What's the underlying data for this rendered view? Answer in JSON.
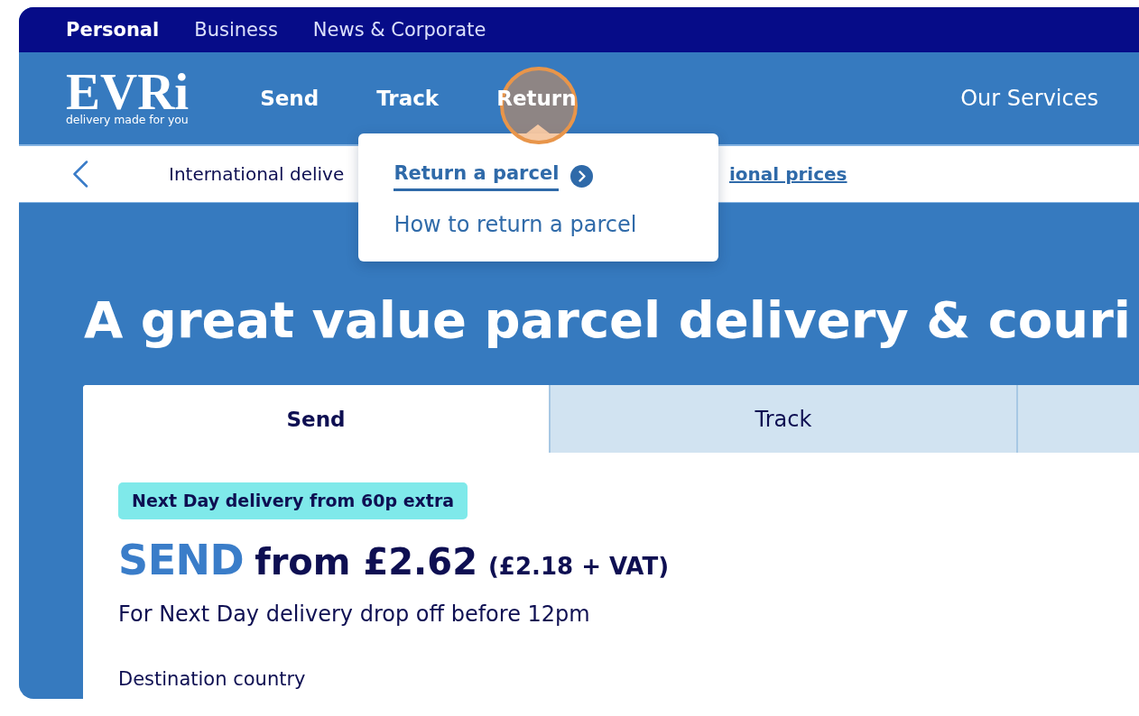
{
  "top_bar": {
    "items": [
      {
        "label": "Personal",
        "selected": true
      },
      {
        "label": "Business",
        "selected": false
      },
      {
        "label": "News & Corporate",
        "selected": false
      }
    ]
  },
  "header": {
    "logo": {
      "wordmark": "EVRi",
      "tagline": "delivery made for you"
    },
    "nav": [
      {
        "label": "Send",
        "expanded": false,
        "highlighted": false
      },
      {
        "label": "Track",
        "expanded": false,
        "highlighted": false
      },
      {
        "label": "Return",
        "expanded": true,
        "highlighted": true,
        "menu": [
          {
            "label": "Return a parcel",
            "selected": true
          },
          {
            "label": "How to return a parcel",
            "selected": false
          }
        ]
      }
    ],
    "services_link": "Our Services"
  },
  "info_bar": {
    "text": "International delive",
    "link": "ional prices"
  },
  "hero": {
    "title": "A great value parcel delivery & couri",
    "card": {
      "tabs": [
        {
          "label": "Send",
          "selected": true
        },
        {
          "label": "Track",
          "selected": false
        },
        {
          "selected": false
        }
      ],
      "badge": "Next Day delivery from 60p extra",
      "wordmark": "SEND",
      "price": "from £2.62",
      "price_note": "(£2.18 + VAT)",
      "note": "For Next Day delivery drop off before 12pm",
      "field_label": "Destination country"
    }
  }
}
